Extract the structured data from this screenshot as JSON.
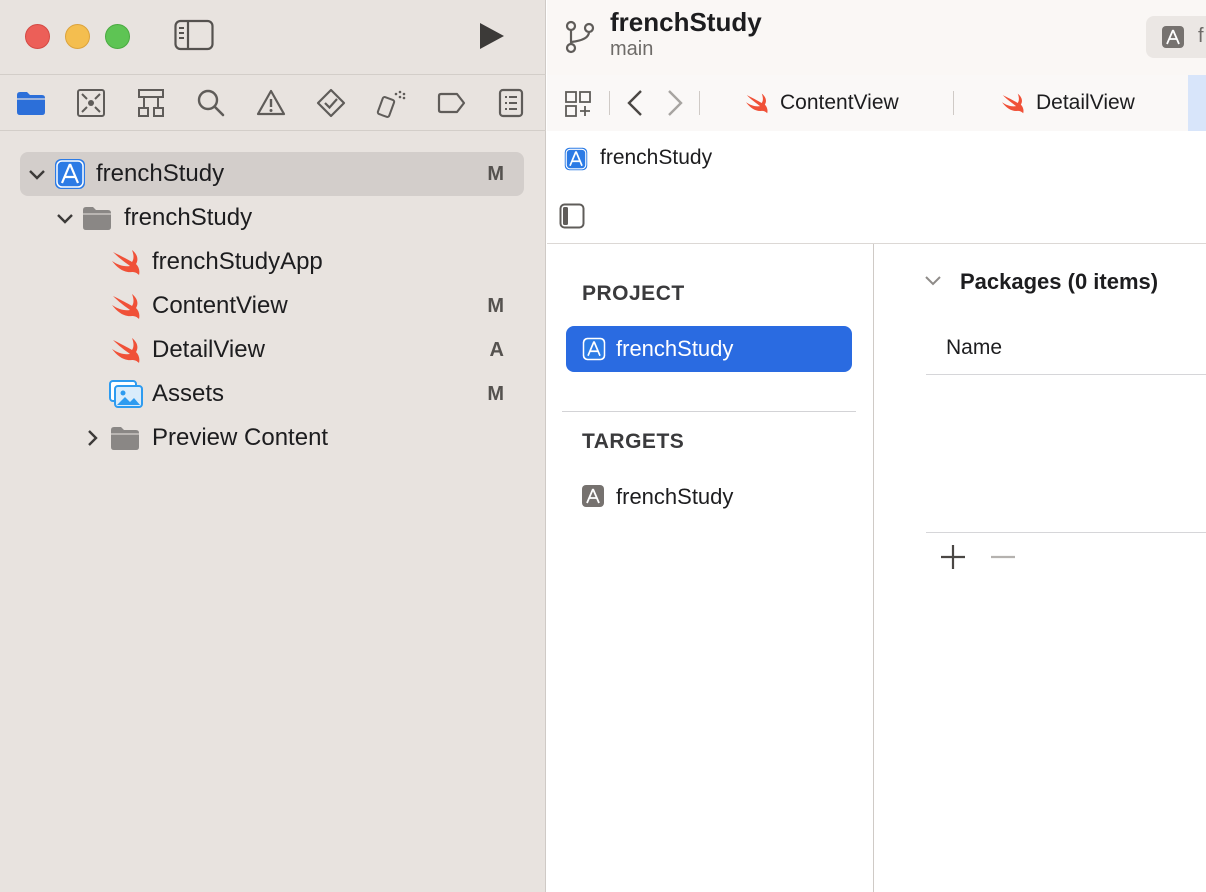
{
  "window": {
    "project_name": "frenchStudy",
    "branch": "main",
    "scheme_initial": "f"
  },
  "navigator_icons": [
    "folder-icon",
    "source-control-icon",
    "symbol-icon",
    "search-icon",
    "warning-icon",
    "test-icon",
    "debug-icon",
    "breakpoint-icon",
    "report-icon"
  ],
  "tree": [
    {
      "label": "frenchStudy",
      "badge": "M"
    },
    {
      "label": "frenchStudy",
      "badge": ""
    },
    {
      "label": "frenchStudyApp",
      "badge": ""
    },
    {
      "label": "ContentView",
      "badge": "M"
    },
    {
      "label": "DetailView",
      "badge": "A"
    },
    {
      "label": "Assets",
      "badge": "M"
    },
    {
      "label": "Preview Content",
      "badge": ""
    }
  ],
  "tabs": [
    {
      "label": "ContentView"
    },
    {
      "label": "DetailView"
    }
  ],
  "jumpbar": {
    "label": "frenchStudy"
  },
  "project_list": {
    "project_header": "PROJECT",
    "project_item": "frenchStudy",
    "targets_header": "TARGETS",
    "target_item": "frenchStudy"
  },
  "packages": {
    "title": "Packages (0 items)",
    "column_name": "Name"
  },
  "colors": {
    "accent": "#2a6be1",
    "swift": "#f05138",
    "sidebar_bg": "#e8e3df"
  }
}
